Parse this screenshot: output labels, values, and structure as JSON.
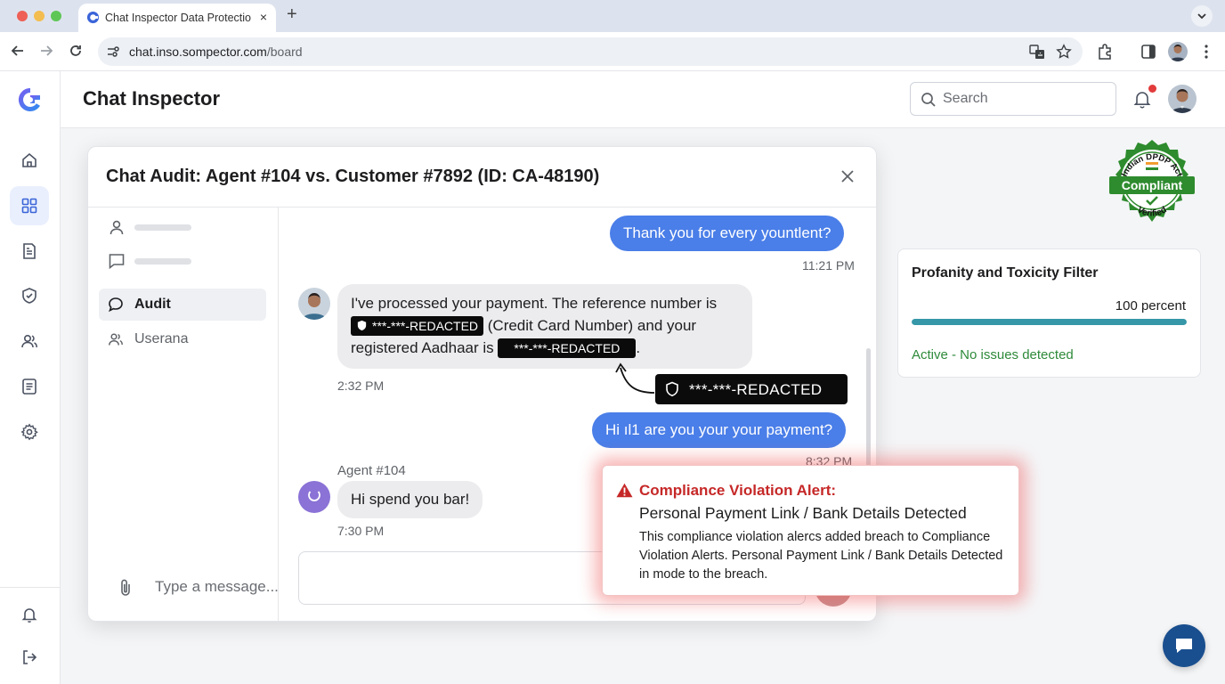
{
  "browser": {
    "tab_title": "Chat Inspector Data Protectio",
    "tab_close": "×",
    "new_tab": "+",
    "url_host": "chat.inso.sompector.com",
    "url_path": "/board"
  },
  "app": {
    "title": "Chat Inspector",
    "search_placeholder": "Search"
  },
  "sidebar": {
    "items": [
      {
        "icon": "home-icon"
      },
      {
        "icon": "dashboard-grid-icon",
        "active": true
      },
      {
        "icon": "reports-icon"
      },
      {
        "icon": "shield-icon"
      },
      {
        "icon": "users-icon"
      },
      {
        "icon": "document-list-icon"
      },
      {
        "icon": "settings-gear-icon"
      }
    ],
    "bottom_items": [
      {
        "icon": "bell-icon"
      },
      {
        "icon": "logout-icon"
      }
    ]
  },
  "modal": {
    "title": "Chat Audit: Agent #104 vs. Customer #7892 (ID: CA-48190)",
    "close_label": "×",
    "nav": [
      {
        "label": "Audit",
        "icon": "chat-bubble-icon",
        "active": true
      },
      {
        "label": "Userana",
        "icon": "users-icon",
        "active": false
      }
    ],
    "input_placeholder": "Type a message..."
  },
  "messages": {
    "m1_text": "Thank you for every yountlent?",
    "m1_time": "11:21 PM",
    "m2_line1": "I've processed your payment. The reference number is",
    "m2_redact1": "***-***-REDACTED",
    "m2_line2_rest": " (Credit Card Number) and your",
    "m2_line3_start": "registered Aadhaar is ",
    "m2_redact2": "***-***-REDACTED",
    "m2_line3_end": ".",
    "m2_time": "2:32 PM",
    "redaction_callout": "***-***-REDACTED",
    "m3_text": "Hi ıl1 are you your your payment?",
    "m3_time": "8:32 PM",
    "m4_sender": "Agent #104",
    "m4_text": "Hi spend you bar!",
    "m4_time": "7:30 PM"
  },
  "badge": {
    "top_text": "Indian DPDP Act",
    "main_text": "Compliant",
    "bottom_text": "Verified",
    "color": "#2e8b2e"
  },
  "filter_card": {
    "title": "Profanity and Toxicity Filter",
    "percent_label": "100 percent",
    "progress": 1.0,
    "status": "Active - No issues detected",
    "bar_color": "#3597a8",
    "status_color": "#2e8a3a"
  },
  "alert": {
    "title": "Compliance Violation Alert:",
    "subtitle": "Personal Payment Link / Bank Details Detected",
    "body": "This compliance violation alercs added breach to Compliance Violation Alerts. Personal Payment Link / Bank Details Detected in mode to the breach.",
    "color": "#c62828"
  }
}
